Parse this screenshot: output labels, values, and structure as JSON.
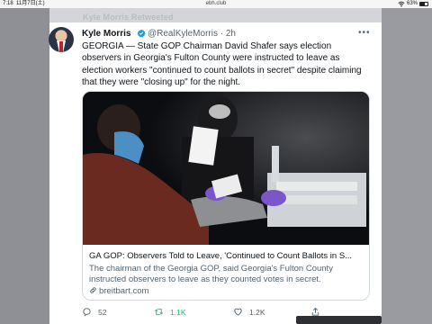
{
  "statusbar": {
    "time": "7:18",
    "date": "11月7日(土)",
    "url": "ebh.club",
    "battery_percent": "63%",
    "battery_level": 0.63
  },
  "background": {
    "faded_header": "Kyle Morris Retweeted"
  },
  "tweet": {
    "author_name": "Kyle Morris",
    "handle_time": "@RealKyleMorris · 2h",
    "text": "GEORGIA — State GOP Chairman David Shafer says election observers in Georgia's Fulton County were instructed to leave as election workers \"continued to count ballots in secret\" despite claiming that they were \"closing up\" for the night.",
    "card": {
      "title": "GA GOP: Observers Told to Leave, 'Continued to Count Ballots in S...",
      "description": "The chairman of the Georgia GOP, said Georgia's Fulton County instructed observers to leave as they counted votes in secret.",
      "domain": "breitbart.com"
    },
    "actions": {
      "replies": "52",
      "retweets": "1.1K",
      "likes": "1.2K"
    }
  },
  "colors": {
    "accent": "#1d9bf0",
    "retweet": "#17bf63",
    "text": "#0f1419",
    "muted": "#536471"
  }
}
